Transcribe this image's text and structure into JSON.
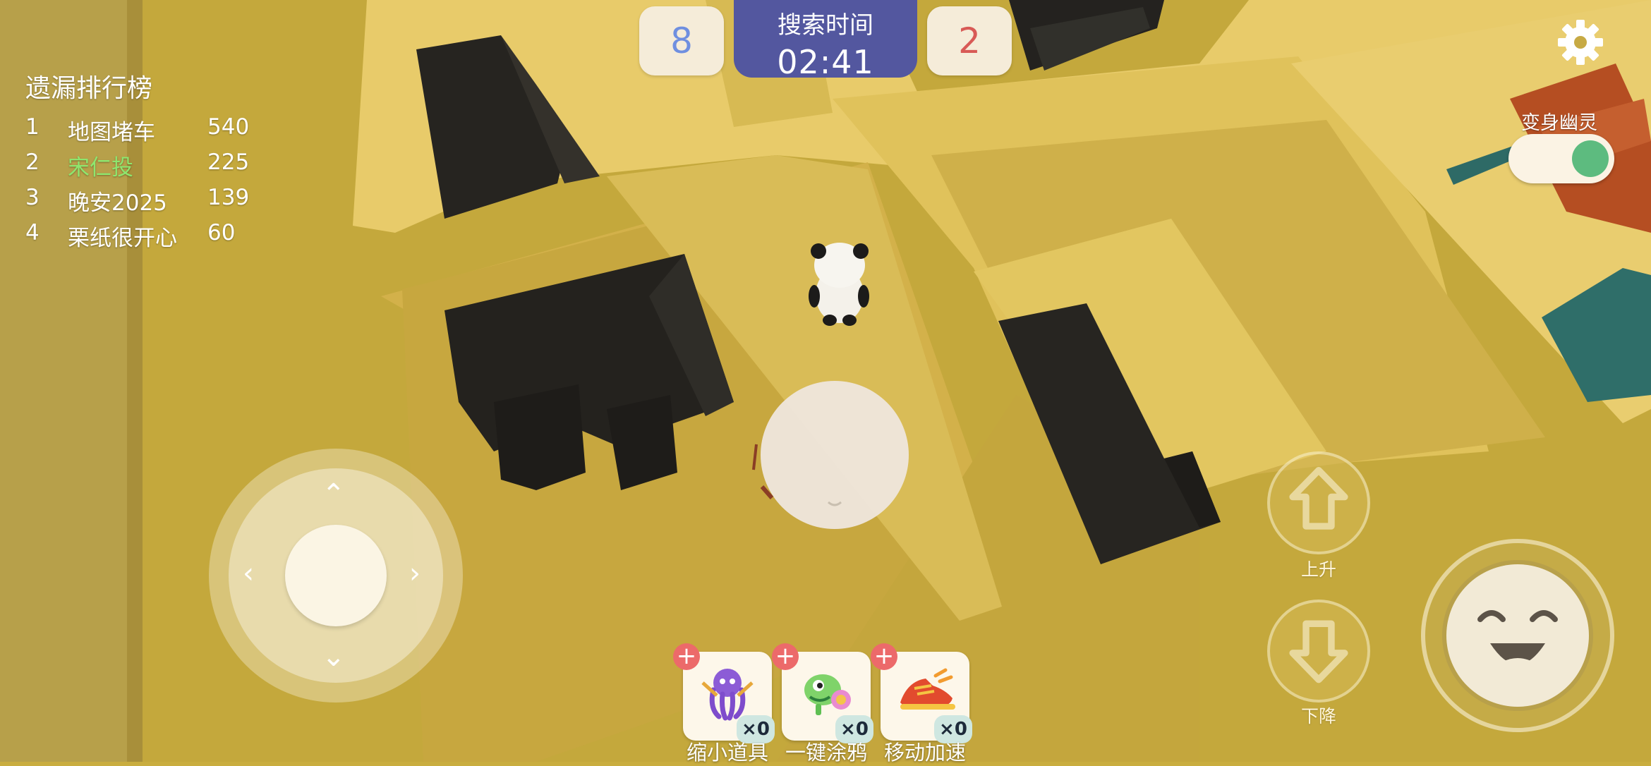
{
  "hud": {
    "team_left_score": "8",
    "team_right_score": "2",
    "timer_label": "搜索时间",
    "timer_value": "02:41",
    "settings_icon": "gear-icon"
  },
  "leaderboard": {
    "title": "遗漏排行榜",
    "rows": [
      {
        "rank": "1",
        "name": "地图堵车",
        "score": "540"
      },
      {
        "rank": "2",
        "name": "宋仁投",
        "score": "225"
      },
      {
        "rank": "3",
        "name": "晚安2025",
        "score": "139"
      },
      {
        "rank": "4",
        "name": "栗纸很开心",
        "score": "60"
      }
    ]
  },
  "ghost_toggle": {
    "label": "变身幽灵",
    "on": true
  },
  "controls": {
    "up_label": "上升",
    "down_label": "下降"
  },
  "items": [
    {
      "label": "缩小道具",
      "count": "×0",
      "icon": "purple-octopus-icon"
    },
    {
      "label": "一键涂鸦",
      "count": "×0",
      "icon": "chameleon-icon"
    },
    {
      "label": "移动加速",
      "count": "×0",
      "icon": "speed-shoe-icon"
    }
  ],
  "colors": {
    "timer_bg": "#53579f",
    "left_team": "#6f8fe0",
    "right_team": "#d85a56",
    "highlight_name": "#8ee66e",
    "toggle_on": "#5dbb7f"
  }
}
